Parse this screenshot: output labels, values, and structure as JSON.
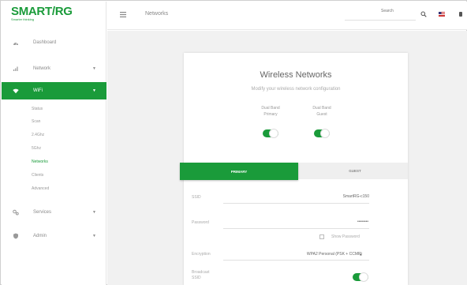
{
  "brand": {
    "logo": "SMART/RG",
    "tagline": "Smarter thinking"
  },
  "sidebar": {
    "items": [
      {
        "label": "Dashboard",
        "icon": "dashboard-icon"
      },
      {
        "label": "Network",
        "icon": "network-icon",
        "caret": "▼"
      },
      {
        "label": "WiFi",
        "icon": "wifi-icon",
        "caret": "▼"
      },
      {
        "label": "Services",
        "icon": "services-icon",
        "caret": "▼"
      },
      {
        "label": "Admin",
        "icon": "admin-icon",
        "caret": "▼"
      }
    ],
    "wifi_subitems": [
      "Status",
      "Scan",
      "2.4Ghz",
      "5Ghz",
      "Networks",
      "Clients",
      "Advanced"
    ]
  },
  "topbar": {
    "title": "Networks",
    "search_placeholder": "Search"
  },
  "card": {
    "title": "Wireless Networks",
    "subtitle": "Modify your wireless network configuration",
    "bands": [
      {
        "line1": "Dual Band",
        "line2": "Primary",
        "enabled": true
      },
      {
        "line1": "Dual Band",
        "line2": "Guest",
        "enabled": true
      }
    ],
    "tabs": {
      "primary": "PRIMARY",
      "guest": "GUEST"
    },
    "fields": {
      "ssid_label": "SSID",
      "ssid_value": "SmartRG-c150",
      "password_label": "Password",
      "password_value": "••••••••",
      "show_password_label": "Show Password",
      "encryption_label": "Encryption",
      "encryption_value": "WPA2 Personal (PSK + CCMP)",
      "broadcast_label_line1": "Broadcast",
      "broadcast_label_line2": "SSID",
      "broadcast_enabled": true
    }
  },
  "colors": {
    "accent": "#1a9b3a",
    "background": "#f1f1f1"
  }
}
